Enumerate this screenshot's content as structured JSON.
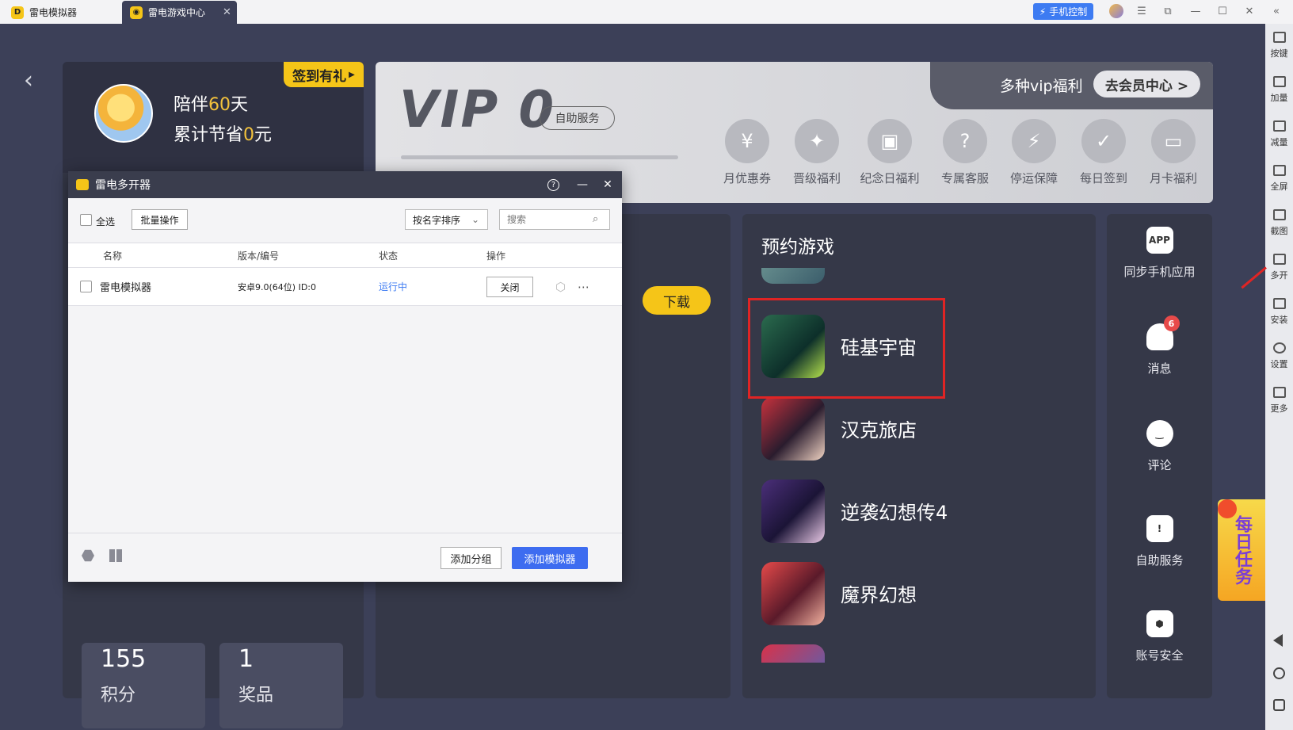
{
  "tabs": [
    {
      "label": "雷电模拟器"
    },
    {
      "label": "雷电游戏中心",
      "close": "✕"
    }
  ],
  "topbar": {
    "phone_control": "手机控制"
  },
  "right_toolbar": [
    "按键",
    "加量",
    "减量",
    "全屏",
    "截图",
    "多开",
    "安装",
    "设置",
    "更多"
  ],
  "user": {
    "accompany_prefix": "陪伴",
    "accompany_days": "60",
    "accompany_suffix": "天",
    "saved_prefix": "累计节省",
    "saved_amount": "0",
    "saved_suffix": "元",
    "signin_badge": "签到有礼",
    "points_value": "155",
    "points_label": "积分",
    "prizes_value": "1",
    "prizes_label": "奖品"
  },
  "vip": {
    "level": "VIP 0",
    "self_service": "自助服务",
    "welfare_text": "多种vip福利",
    "center_button": "去会员中心 >",
    "benefits": [
      "月优惠券",
      "晋级福利",
      "纪念日福利",
      "专属客服",
      "停运保障",
      "每日签到",
      "月卡福利"
    ]
  },
  "mid": {
    "download": "下载"
  },
  "reserve": {
    "title": "预约游戏",
    "games": [
      "硅基宇宙",
      "汉克旅店",
      "逆袭幻想传4",
      "魔界幻想"
    ]
  },
  "side": {
    "sync_app": "同步手机应用",
    "sync_icon_text": "APP",
    "message": "消息",
    "message_badge": "6",
    "comment": "评论",
    "self_service": "自助服务",
    "account_security": "账号安全"
  },
  "daily_task": "每日任务",
  "dialog": {
    "title": "雷电多开器",
    "select_all": "全选",
    "batch": "批量操作",
    "sort": "按名字排序",
    "search_placeholder": "搜索",
    "columns": [
      "名称",
      "版本/编号",
      "状态",
      "操作"
    ],
    "rows": [
      {
        "name": "雷电模拟器",
        "version": "安卓9.0(64位)  ID:0",
        "status": "运行中",
        "action": "关闭"
      }
    ],
    "add_group": "添加分组",
    "add_emulator": "添加模拟器"
  },
  "colors": {
    "accent": "#f5c518",
    "primary_blue": "#3d6cf0",
    "status_blue": "#3d7bf2",
    "highlight_red": "#e02424"
  }
}
